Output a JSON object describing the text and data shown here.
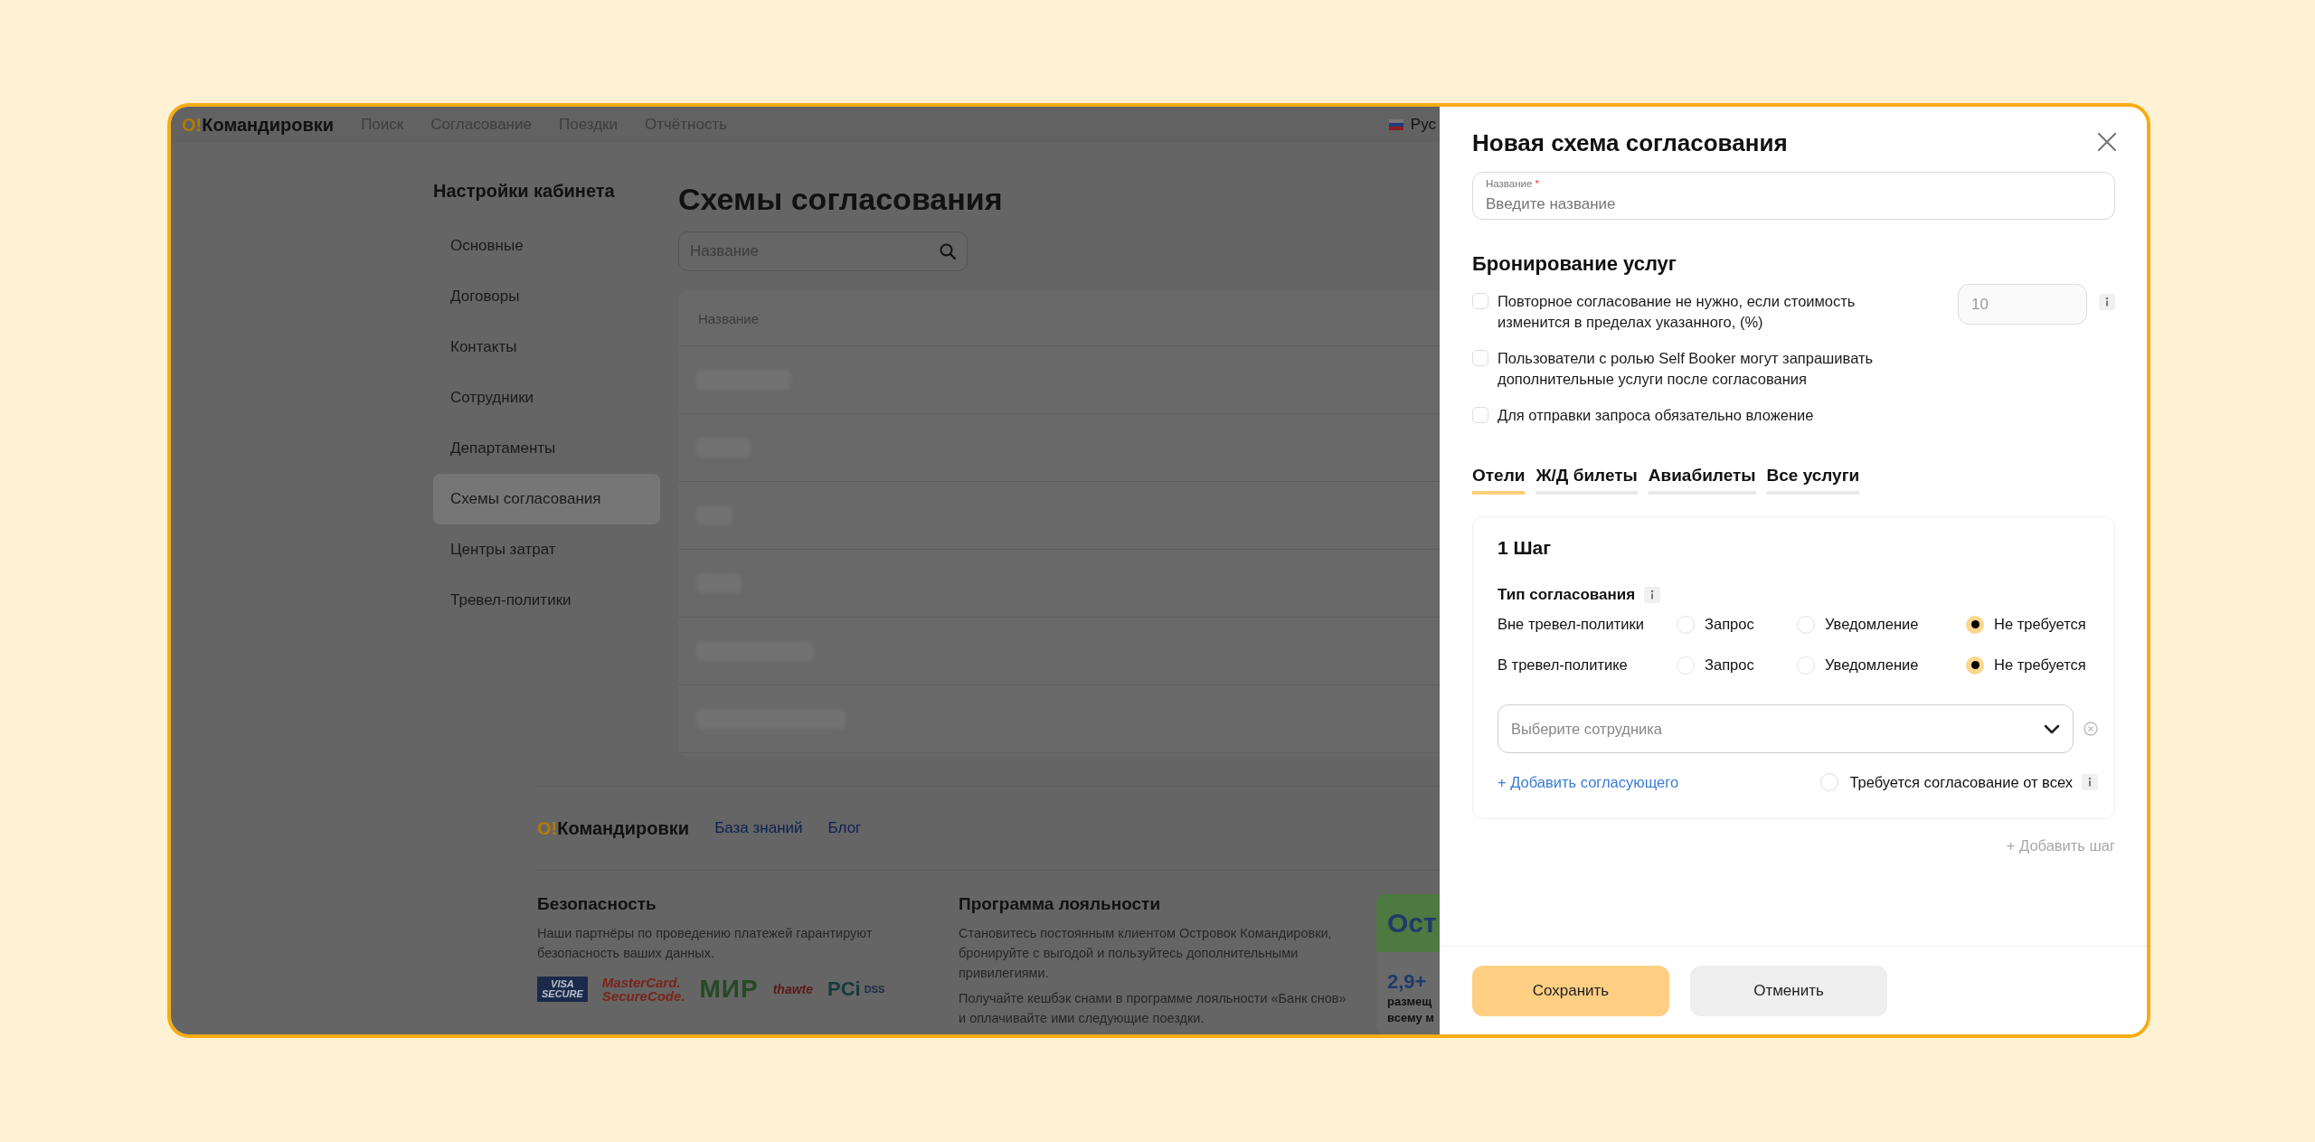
{
  "nav": {
    "logo_mark": "О!",
    "logo_text": "Командировки",
    "links": [
      "Поиск",
      "Согласование",
      "Поездки",
      "Отчётность"
    ],
    "language": "Рус"
  },
  "sidebar": {
    "title": "Настройки кабинета",
    "items": [
      {
        "label": "Основные",
        "selected": false
      },
      {
        "label": "Договоры",
        "selected": false
      },
      {
        "label": "Контакты",
        "selected": false
      },
      {
        "label": "Сотрудники",
        "selected": false
      },
      {
        "label": "Департаменты",
        "selected": false
      },
      {
        "label": "Схемы согласования",
        "selected": true
      },
      {
        "label": "Центры затрат",
        "selected": false
      },
      {
        "label": "Тревел-политики",
        "selected": false
      }
    ]
  },
  "main": {
    "title": "Схемы согласования",
    "search": {
      "placeholder": "Название"
    },
    "table": {
      "columns": [
        "Название"
      ]
    }
  },
  "footer": {
    "logo_mark": "О!",
    "logo_text": "Командировки",
    "links": [
      "База знаний",
      "Блог"
    ],
    "security": {
      "title": "Безопасность",
      "text": "Наши партнёры по проведению платежей гарантируют безопасность ваших данных.",
      "logos": [
        {
          "kind": "visa",
          "lines": [
            "VISA",
            "SECURE"
          ]
        },
        {
          "kind": "mastercard",
          "lines": [
            "MasterCard.",
            "SecureCode."
          ]
        },
        {
          "kind": "mir",
          "lines": [
            "МИР"
          ]
        },
        {
          "kind": "thawte",
          "lines": [
            "thawte"
          ]
        },
        {
          "kind": "pci",
          "lines": [
            "PCi",
            "DSS"
          ]
        }
      ]
    },
    "loyalty": {
      "title": "Программа лояльности",
      "paragraphs": [
        "Становитесь постоянным клиентом Островок Командировки, бронируйте с выгодой и пользуйтесь дополнительными привилегиями.",
        "Получайте кешбэк снами в программе лояльности «Банк снов» и оплачивайте ими следующие поездки."
      ]
    },
    "promo": {
      "title": "Ост",
      "value": "2,9+",
      "lines": [
        "размещ",
        "всему м"
      ]
    }
  },
  "dialog": {
    "title": "Новая схема согласования",
    "name_field": {
      "label": "Название",
      "required_mark": "*",
      "placeholder": "Введите название"
    },
    "section_title": "Бронирование услуг",
    "options": [
      {
        "label": "Повторное согласование не нужно, если стоимость изменится в пределах указанного, (%)",
        "checked": false,
        "input": {
          "value": "10",
          "disabled": true
        }
      },
      {
        "label": "Пользователи с ролью Self Booker могут запрашивать дополнительные услуги после согласования",
        "checked": false
      },
      {
        "label": "Для отправки запроса обязательно вложение",
        "checked": false
      }
    ],
    "tabs": [
      {
        "label": "Отели",
        "selected": true
      },
      {
        "label": "Ж/Д билеты",
        "selected": false
      },
      {
        "label": "Авиабилеты",
        "selected": false
      },
      {
        "label": "Все услуги",
        "selected": false
      }
    ],
    "step": {
      "title": "1 Шаг",
      "type_title": "Тип согласования",
      "rows": [
        {
          "label": "Вне тревел-политики",
          "options": [
            {
              "label": "Запрос",
              "selected": false
            },
            {
              "label": "Уведомление",
              "selected": false
            },
            {
              "label": "Не требуется",
              "selected": true
            }
          ]
        },
        {
          "label": "В тревел-политике",
          "options": [
            {
              "label": "Запрос",
              "selected": false
            },
            {
              "label": "Уведомление",
              "selected": false
            },
            {
              "label": "Не требуется",
              "selected": true
            }
          ]
        }
      ],
      "approver": {
        "placeholder": "Выберите сотрудника"
      },
      "add_link": "+ Добавить согласующего",
      "require_all": {
        "label": "Требуется согласование от всех",
        "checked": false
      }
    },
    "add_step": {
      "label": "+ Добавить шаг",
      "disabled": true
    },
    "buttons": [
      {
        "label": "Сохранить",
        "kind": "primary"
      },
      {
        "label": "Отменить",
        "kind": "secondary"
      }
    ]
  }
}
